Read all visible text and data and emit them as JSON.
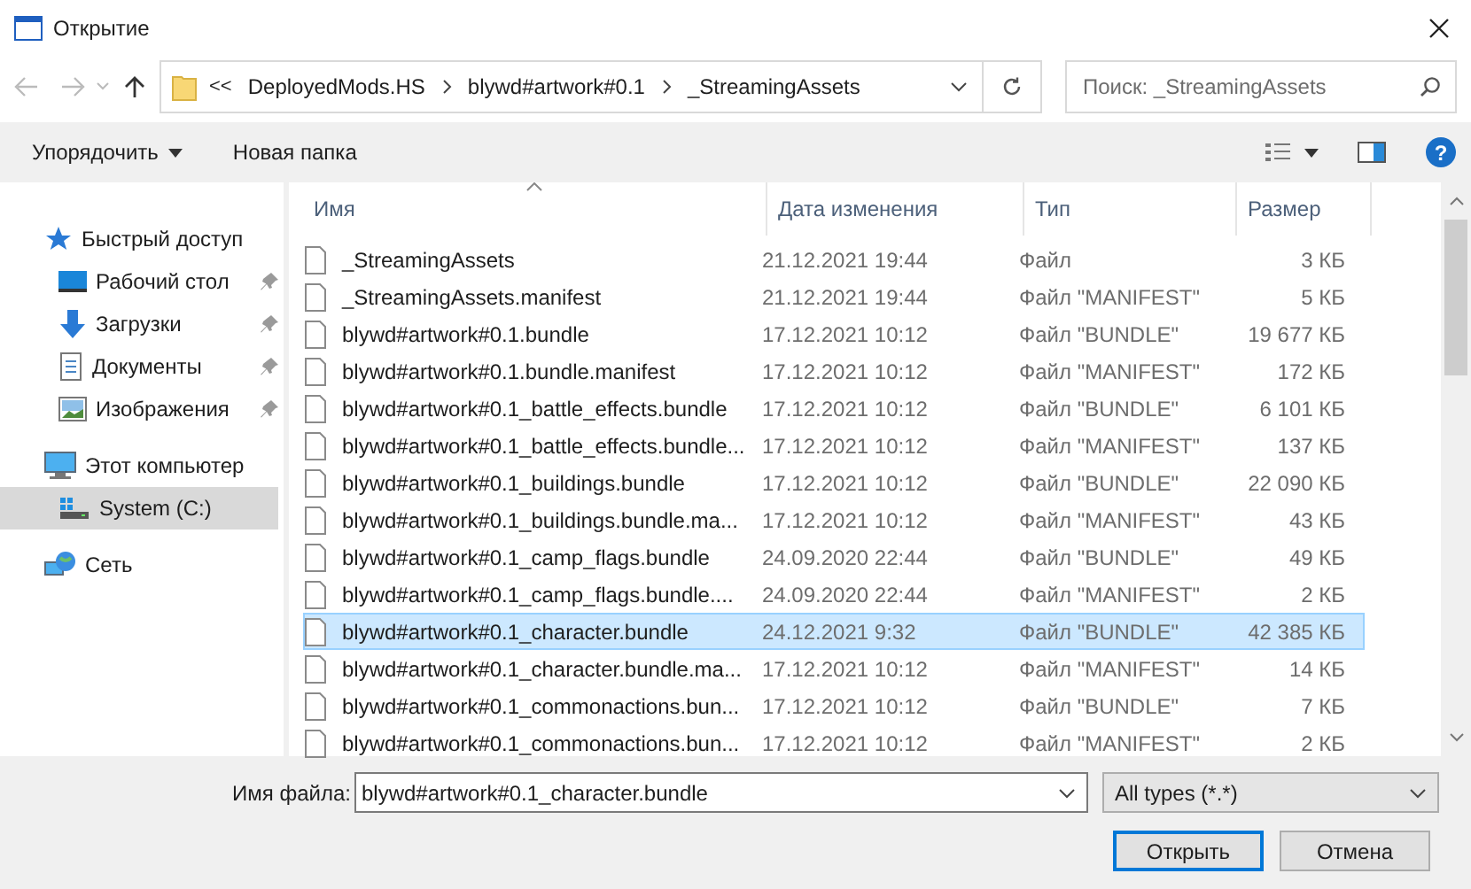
{
  "window": {
    "title": "Открытие"
  },
  "address": {
    "overflow": "<<",
    "segments": [
      "DeployedMods.HS",
      "blywd#artwork#0.1",
      "_StreamingAssets"
    ]
  },
  "search": {
    "placeholder": "Поиск: _StreamingAssets"
  },
  "toolbar": {
    "organize": "Упорядочить",
    "new_folder": "Новая папка",
    "help": "?"
  },
  "sidebar": {
    "items": [
      {
        "label": "Быстрый доступ",
        "kind": "star",
        "selected": false,
        "children": [
          {
            "label": "Рабочий стол",
            "kind": "desktop",
            "pinned": true,
            "selected": false
          },
          {
            "label": "Загрузки",
            "kind": "download",
            "pinned": true,
            "selected": false
          },
          {
            "label": "Документы",
            "kind": "document",
            "pinned": true,
            "selected": false
          },
          {
            "label": "Изображения",
            "kind": "image",
            "pinned": true,
            "selected": false
          }
        ]
      },
      {
        "label": "Этот компьютер",
        "kind": "computer",
        "selected": false,
        "children": [
          {
            "label": "System (C:)",
            "kind": "drive",
            "pinned": false,
            "selected": true
          }
        ]
      },
      {
        "label": "Сеть",
        "kind": "network",
        "selected": false
      }
    ]
  },
  "table": {
    "columns": [
      "Имя",
      "Дата изменения",
      "Тип",
      "Размер"
    ],
    "rows": [
      {
        "name": "_StreamingAssets",
        "date": "21.12.2021 19:44",
        "type": "Файл",
        "size": "3 КБ",
        "selected": false
      },
      {
        "name": "_StreamingAssets.manifest",
        "date": "21.12.2021 19:44",
        "type": "Файл \"MANIFEST\"",
        "size": "5 КБ",
        "selected": false
      },
      {
        "name": "blywd#artwork#0.1.bundle",
        "date": "17.12.2021 10:12",
        "type": "Файл \"BUNDLE\"",
        "size": "19 677 КБ",
        "selected": false
      },
      {
        "name": "blywd#artwork#0.1.bundle.manifest",
        "date": "17.12.2021 10:12",
        "type": "Файл \"MANIFEST\"",
        "size": "172 КБ",
        "selected": false
      },
      {
        "name": "blywd#artwork#0.1_battle_effects.bundle",
        "date": "17.12.2021 10:12",
        "type": "Файл \"BUNDLE\"",
        "size": "6 101 КБ",
        "selected": false
      },
      {
        "name": "blywd#artwork#0.1_battle_effects.bundle...",
        "date": "17.12.2021 10:12",
        "type": "Файл \"MANIFEST\"",
        "size": "137 КБ",
        "selected": false
      },
      {
        "name": "blywd#artwork#0.1_buildings.bundle",
        "date": "17.12.2021 10:12",
        "type": "Файл \"BUNDLE\"",
        "size": "22 090 КБ",
        "selected": false
      },
      {
        "name": "blywd#artwork#0.1_buildings.bundle.ma...",
        "date": "17.12.2021 10:12",
        "type": "Файл \"MANIFEST\"",
        "size": "43 КБ",
        "selected": false
      },
      {
        "name": "blywd#artwork#0.1_camp_flags.bundle",
        "date": "24.09.2020 22:44",
        "type": "Файл \"BUNDLE\"",
        "size": "49 КБ",
        "selected": false
      },
      {
        "name": "blywd#artwork#0.1_camp_flags.bundle....",
        "date": "24.09.2020 22:44",
        "type": "Файл \"MANIFEST\"",
        "size": "2 КБ",
        "selected": false
      },
      {
        "name": "blywd#artwork#0.1_character.bundle",
        "date": "24.12.2021 9:32",
        "type": "Файл \"BUNDLE\"",
        "size": "42 385 КБ",
        "selected": true
      },
      {
        "name": "blywd#artwork#0.1_character.bundle.ma...",
        "date": "17.12.2021 10:12",
        "type": "Файл \"MANIFEST\"",
        "size": "14 КБ",
        "selected": false
      },
      {
        "name": "blywd#artwork#0.1_commonactions.bun...",
        "date": "17.12.2021 10:12",
        "type": "Файл \"BUNDLE\"",
        "size": "7 КБ",
        "selected": false
      },
      {
        "name": "blywd#artwork#0.1_commonactions.bun...",
        "date": "17.12.2021 10:12",
        "type": "Файл \"MANIFEST\"",
        "size": "2 КБ",
        "selected": false
      }
    ]
  },
  "file_name": {
    "label": "Имя файла:",
    "value": "blywd#artwork#0.1_character.bundle"
  },
  "file_type": {
    "value": "All types (*.*)"
  },
  "buttons": [
    {
      "label": "Открыть",
      "default": true
    },
    {
      "label": "Отмена",
      "default": false
    }
  ]
}
